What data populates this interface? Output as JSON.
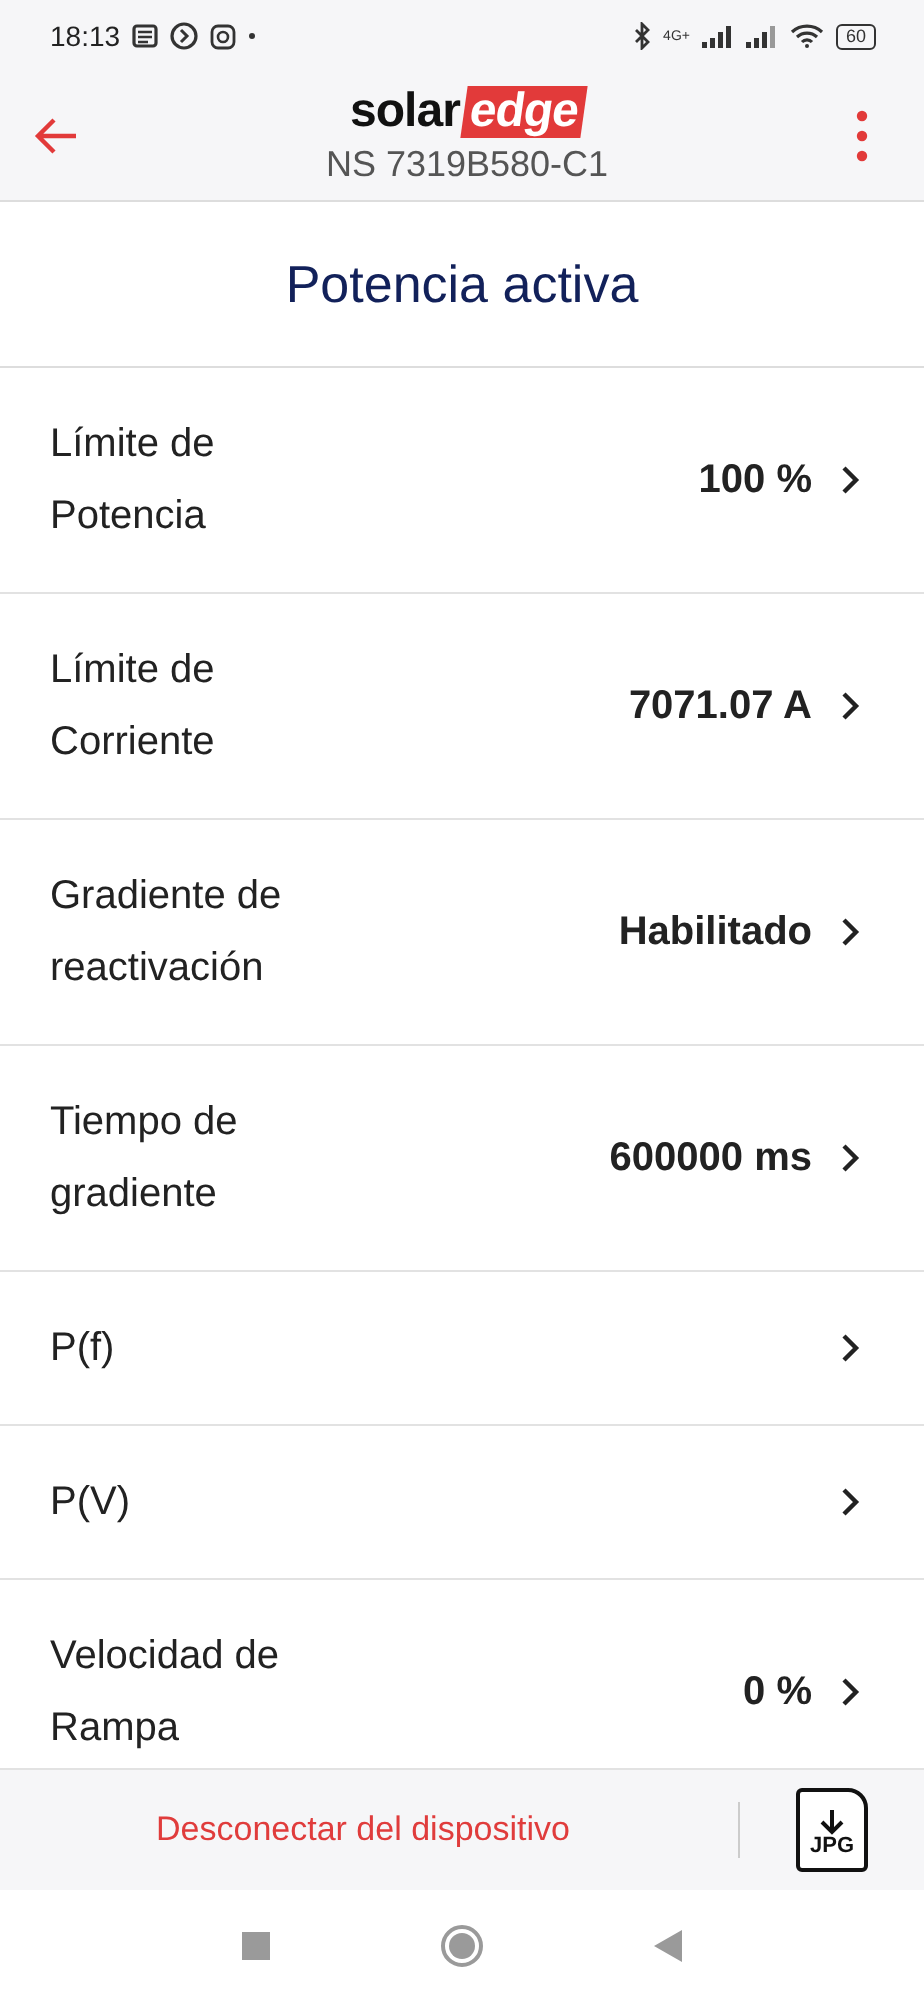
{
  "status_bar": {
    "time": "18:13",
    "network": "4G+",
    "battery": "60"
  },
  "header": {
    "logo": {
      "first": "solar",
      "second": "edge"
    },
    "device": "NS 7319B580-C1"
  },
  "title": "Potencia activa",
  "settings": [
    {
      "label": "Límite de Potencia",
      "value": "100 %"
    },
    {
      "label": "Límite de Corriente",
      "value": "7071.07 A"
    },
    {
      "label": "Gradiente de reactivación",
      "value": "Habilitado"
    },
    {
      "label": "Tiempo de gradiente",
      "value": "600000 ms"
    },
    {
      "label": "P(f)"
    },
    {
      "label": "P(V)"
    },
    {
      "label": "Velocidad de Rampa",
      "value": "0 %"
    }
  ],
  "footer": {
    "disconnect": "Desconectar del dispositivo",
    "export_label": "JPG"
  }
}
